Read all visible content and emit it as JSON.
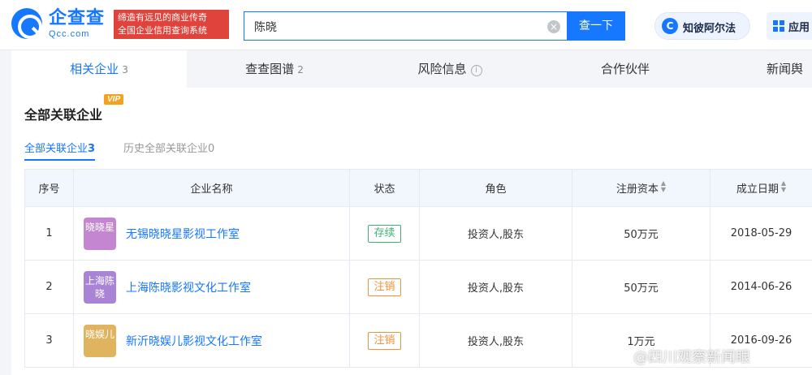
{
  "header": {
    "logo_text": "企查查",
    "logo_sub": "Qcc.com",
    "slogan_line1": "缔造有远见的商业传奇",
    "slogan_line2": "全国企业信用查询系统",
    "search_value": "陈晓",
    "search_button": "查一下",
    "alpha_label": "知彼阿尔法",
    "alpha_icon": "C",
    "apps_label": "应用"
  },
  "tabs": [
    {
      "label": "相关企业",
      "count": "3"
    },
    {
      "label": "查查图谱",
      "count": "2"
    },
    {
      "label": "风险信息",
      "count": ""
    },
    {
      "label": "合作伙伴",
      "count": ""
    },
    {
      "label": "新闻舆",
      "count": ""
    }
  ],
  "section": {
    "title": "全部关联企业",
    "vip": "VIP",
    "subtabs": [
      {
        "label": "全部关联企业",
        "count": "3"
      },
      {
        "label": "历史全部关联企业",
        "count": "0"
      }
    ]
  },
  "table": {
    "headers": [
      "序号",
      "企业名称",
      "状态",
      "角色",
      "注册资本",
      "成立日期"
    ],
    "rows": [
      {
        "index": "1",
        "logo_text": "晓晓星",
        "logo_color": "#c586d1",
        "name": "无锡晓晓星影视工作室",
        "status": "存续",
        "status_color": "#3cb371",
        "role": "投资人,股东",
        "capital": "50万元",
        "date": "2018-05-29"
      },
      {
        "index": "2",
        "logo_text": "上海陈晓",
        "logo_color": "#a984d6",
        "name": "上海陈晓影视文化工作室",
        "status": "注销",
        "status_color": "#f0923a",
        "role": "投资人,股东",
        "capital": "50万元",
        "date": "2014-06-26"
      },
      {
        "index": "3",
        "logo_text": "晓娱儿",
        "logo_color": "#e0b35f",
        "name": "新沂晓娱儿影视文化工作室",
        "status": "注销",
        "status_color": "#f0923a",
        "role": "投资人,股东",
        "capital": "1万元",
        "date": "2016-09-26"
      }
    ]
  },
  "watermark": "@四川观察新闻眼",
  "colors": {
    "brand": "#1677ff",
    "slogan_bg": "#e0433b",
    "vip_bg": "#f4a21d"
  }
}
